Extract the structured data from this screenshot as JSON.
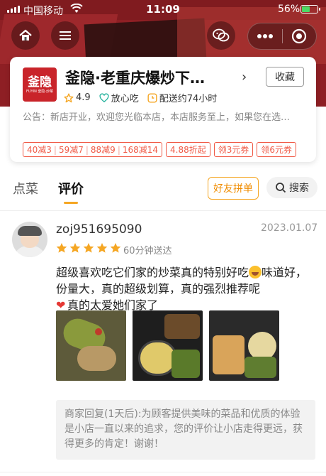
{
  "status_bar": {
    "carrier": "中国移动",
    "time": "11:09",
    "battery": "56%",
    "battery_level": 0.56
  },
  "store": {
    "logo_text": "釜隐",
    "logo_subtext": "FUYIN 釜隐·炒菜",
    "name": "釜隐·老重庆爆炒下…",
    "favorite_label": "收藏",
    "rating": "4.9",
    "safe_label": "放心吃",
    "delivery_time": "配送约74小时",
    "notice": "公告：新店开业，欢迎您光临本店，本店服务至上，如果您在选…",
    "promo_full_reduction": [
      "40减3",
      "59减7",
      "88减9",
      "168减14"
    ],
    "promo_discount": "4.88折起",
    "coupon_1": "领3元券",
    "coupon_2": "领6元券"
  },
  "tabs": {
    "menu": "点菜",
    "reviews": "评价",
    "group_order": "好友拼单",
    "search": "搜索"
  },
  "review": {
    "username": "zoj951695090",
    "date": "2023.01.07",
    "stars": 5,
    "delivery_note": "60分钟送达",
    "text_part1": "超级喜欢吃它们家的炒菜真的特别好吃",
    "text_part2": "味道好，份量大，真的超级划算，真的强烈推荐呢",
    "text_part3": "真的太爱她们家了",
    "merchant_reply": "商家回复(1天后):为顾客提供美味的菜品和优质的体验是小店一直以来的追求，您的评价让小店走得更远，获得更多的肯定！谢谢！"
  },
  "colors": {
    "accent_orange": "#f5a623",
    "promo_red": "#f05a46",
    "banner_red": "#8e1f24",
    "star": "#f5a623"
  }
}
